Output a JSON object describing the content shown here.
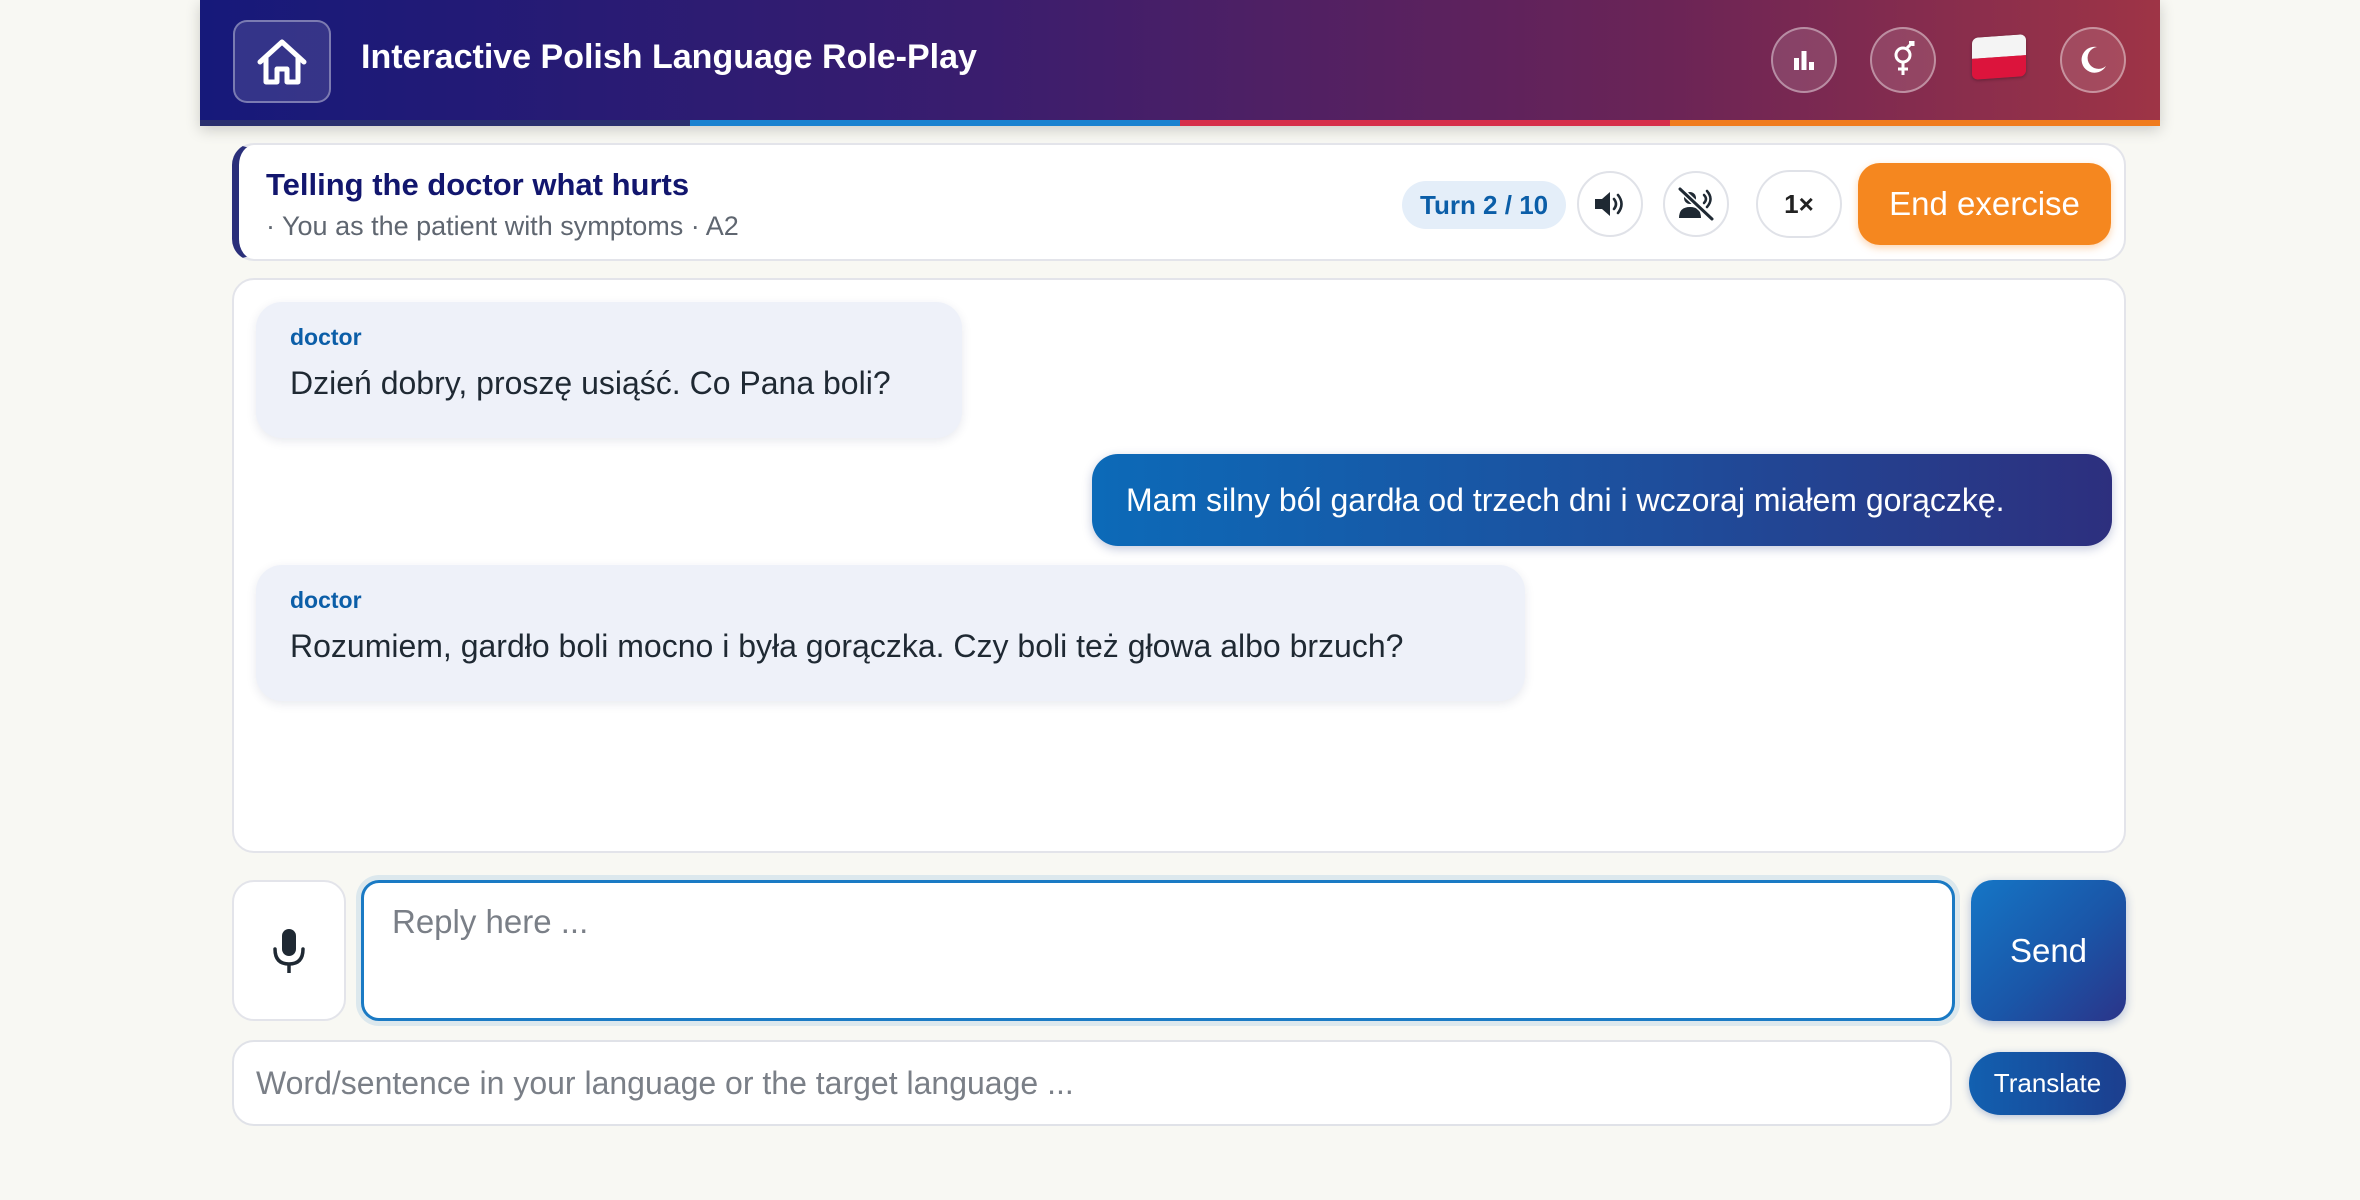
{
  "header": {
    "title": "Interactive Polish Language Role-Play",
    "stripe_colors": [
      "#2a2f6e",
      "#1a82d0",
      "#d62e4a",
      "#f07c1e"
    ],
    "icons": [
      "home-icon",
      "bar-chart-icon",
      "gender-icon",
      "polish-flag-icon",
      "moon-icon"
    ]
  },
  "exercise": {
    "title": "Telling the doctor what hurts",
    "subtitle": "· You as the patient with symptoms · A2",
    "turn": "Turn 2 / 10",
    "speed": "1×",
    "end_label": "End exercise"
  },
  "chat": {
    "messages": [
      {
        "role": "in",
        "speaker": "doctor",
        "text": "Dzień dobry, proszę usiąść. Co Pana boli?"
      },
      {
        "role": "out",
        "text": "Mam silny ból gardła od trzech dni i wczoraj miałem gorączkę."
      },
      {
        "role": "in",
        "speaker": "doctor",
        "text": "Rozumiem, gardło boli mocno i była gorączka. Czy boli też głowa albo brzuch?"
      }
    ]
  },
  "composer": {
    "reply_placeholder": "Reply here ...",
    "send_label": "Send",
    "translate_placeholder": "Word/sentence in your language or the target language ...",
    "translate_label": "Translate"
  },
  "colors": {
    "accent_orange": "#f5871f",
    "primary_blue": "#1576c6",
    "navy": "#12166e"
  }
}
